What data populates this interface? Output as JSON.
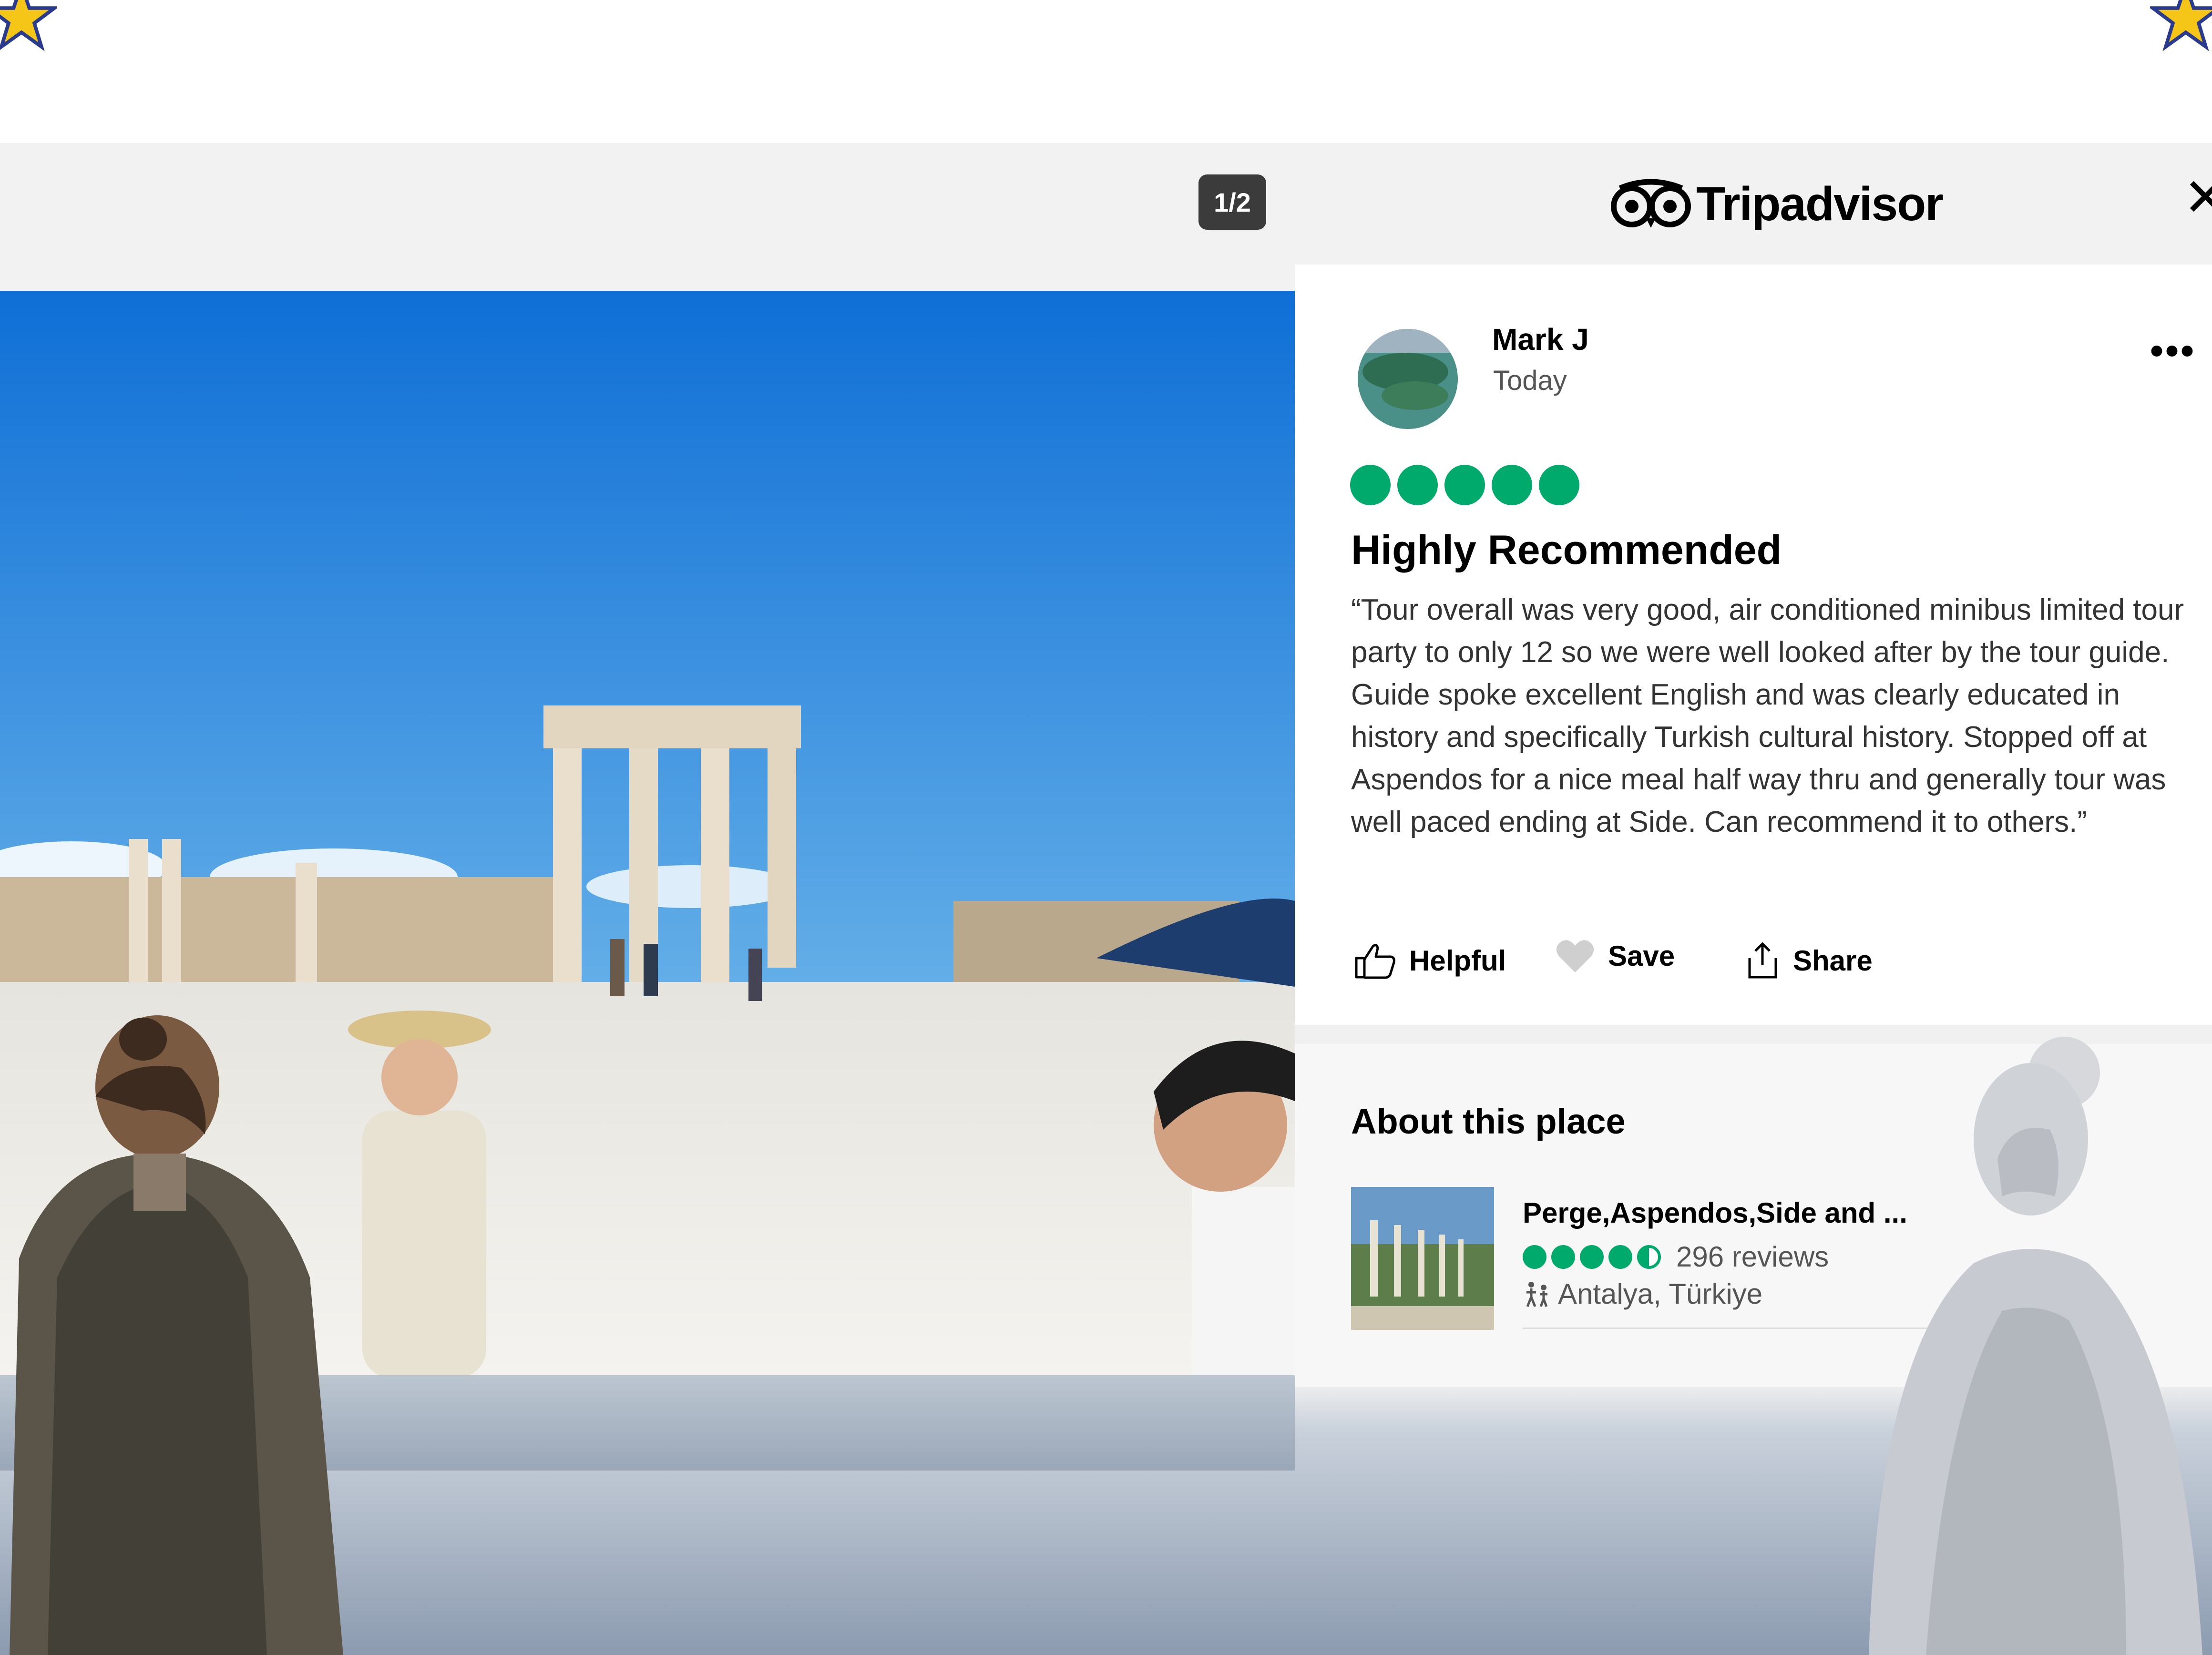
{
  "viewer": {
    "counter": "1/2",
    "close_icon": "close-icon",
    "photo_description_icon": "photo"
  },
  "brand": {
    "name": "Tripadvisor",
    "logo_icon": "owl-eyes-icon"
  },
  "review": {
    "author": "Mark J",
    "date": "Today",
    "rating": 5,
    "rating_max": 5,
    "title": "Highly Recommended",
    "body": "“Tour overall was very good, air conditioned minibus limited tour party to only 12 so we were well looked after by the tour guide. Guide spoke excellent English and was clearly educated in history and specifically Turkish cultural history. Stopped off at Aspendos for a nice meal half way thru and generally tour was well paced ending at Side. Can recommend it to others.”",
    "more_menu": "•••"
  },
  "actions": {
    "helpful": "Helpful",
    "save": "Save",
    "share": "Share"
  },
  "about": {
    "title": "About this place",
    "place_name": "Perge,Aspendos,Side and ...",
    "place_rating": 4.5,
    "place_reviews": "296 reviews",
    "place_location": "Antalya, Türkiye"
  },
  "colors": {
    "rating_green": "#00aa6c",
    "counter_bg": "#3b3b3b",
    "sky_blue": "#1a78d8",
    "star_gold": "#f5c518"
  }
}
